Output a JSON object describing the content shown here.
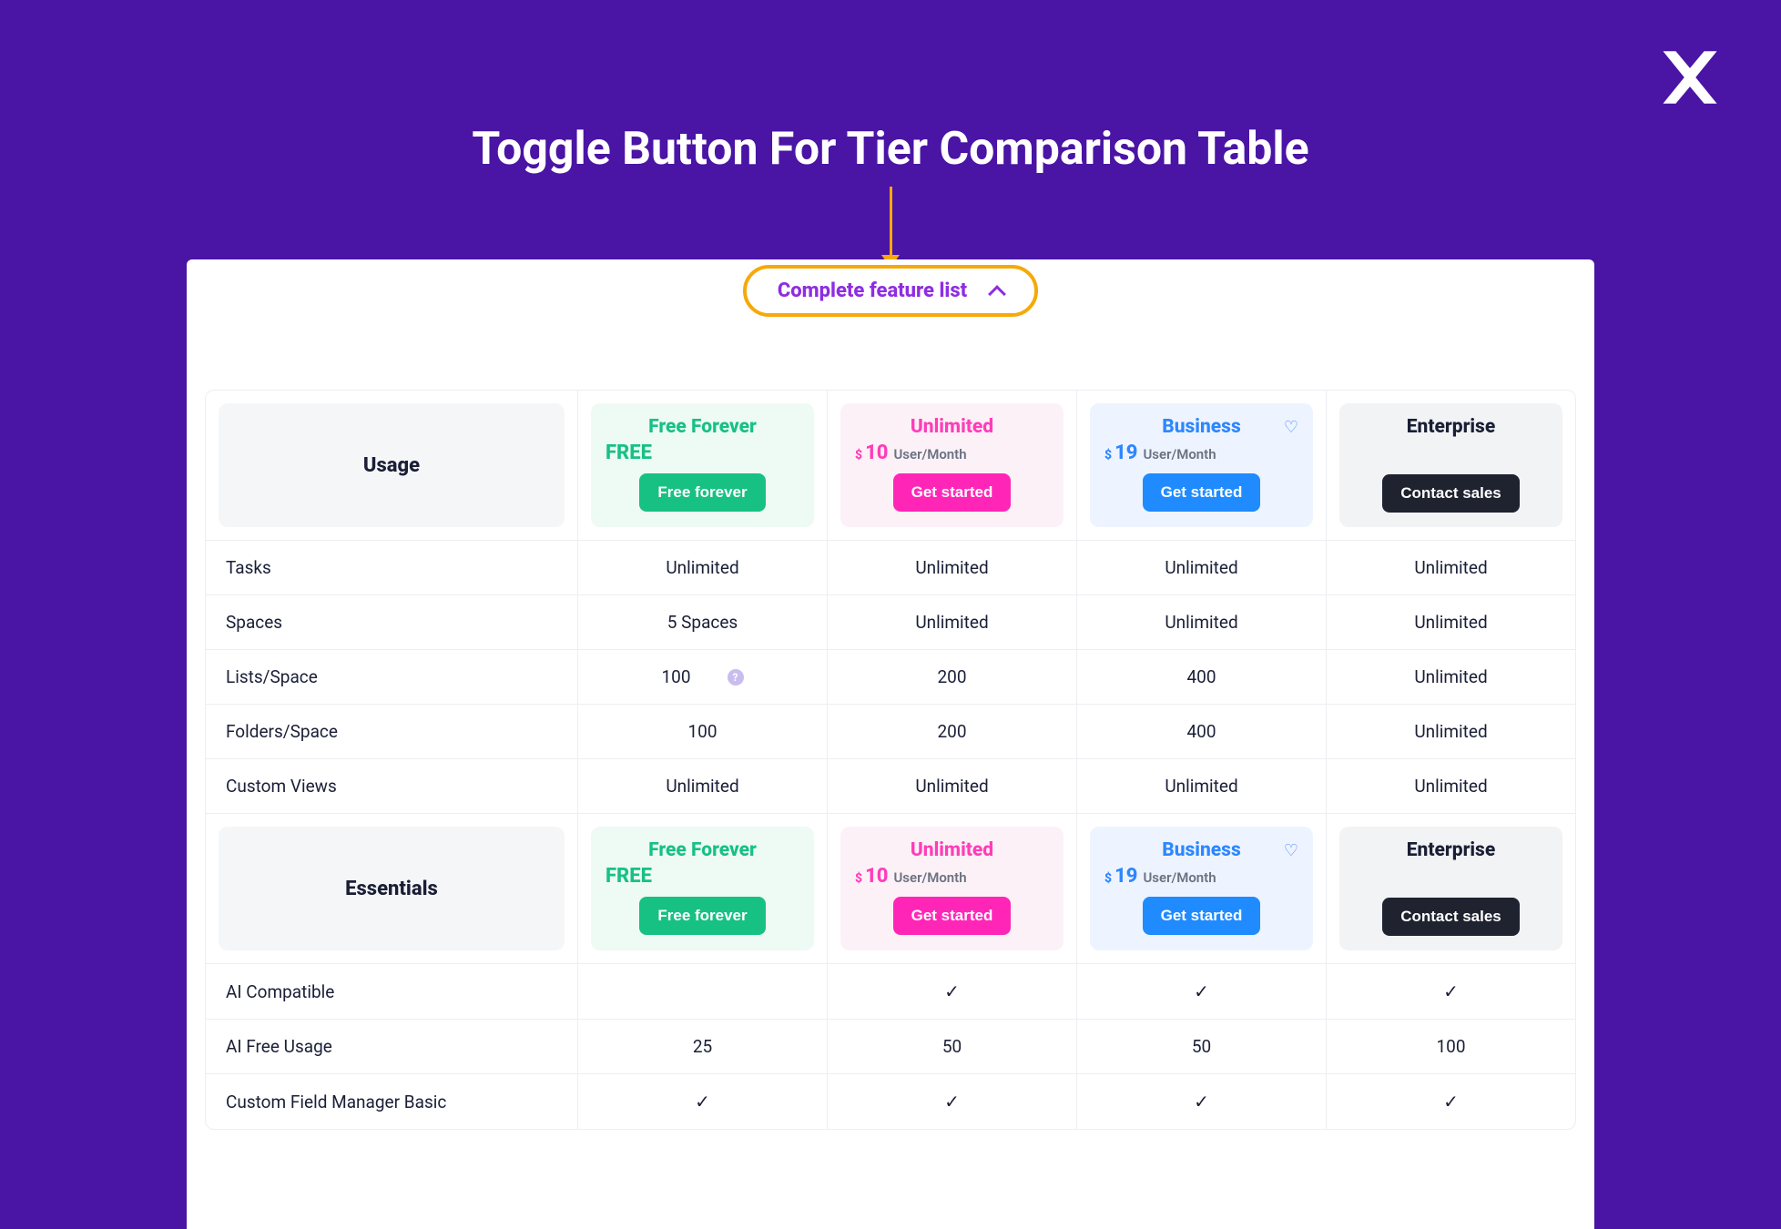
{
  "title": "Toggle Button For Tier Comparison Table",
  "toggle_label": "Complete feature list",
  "plans": {
    "free": {
      "name": "Free Forever",
      "price": "FREE",
      "unit": "",
      "cta": "Free forever",
      "bg": "#eefaf4",
      "name_color": "#17c184",
      "price_color": "#17c184",
      "btn_bg": "#17c184"
    },
    "unlimited": {
      "name": "Unlimited",
      "dollar": "$",
      "price": "10",
      "unit": "User/Month",
      "cta": "Get started",
      "bg": "#fdf1f8",
      "name_color": "#ff3db8",
      "price_color": "#ff3db8",
      "btn_bg": "#ff26b7"
    },
    "business": {
      "name": "Business",
      "dollar": "$",
      "price": "19",
      "unit": "User/Month",
      "cta": "Get started",
      "bg": "#eef4ff",
      "name_color": "#2d87ff",
      "price_color": "#2d87ff",
      "btn_bg": "#1f8bff",
      "heart": "♡"
    },
    "enterprise": {
      "name": "Enterprise",
      "price": "",
      "unit": "",
      "cta": "Contact sales",
      "bg": "#f2f3f5",
      "name_color": "#1a1f36",
      "price_color": "#1a1f36",
      "btn_bg": "#1f2330"
    }
  },
  "sections": [
    {
      "title": "Usage",
      "rows": [
        {
          "label": "Tasks",
          "values": [
            "Unlimited",
            "Unlimited",
            "Unlimited",
            "Unlimited"
          ]
        },
        {
          "label": "Spaces",
          "values": [
            "5 Spaces",
            "Unlimited",
            "Unlimited",
            "Unlimited"
          ]
        },
        {
          "label": "Lists/Space",
          "values": [
            "100",
            "200",
            "400",
            "Unlimited"
          ],
          "help_after_col": 0
        },
        {
          "label": "Folders/Space",
          "values": [
            "100",
            "200",
            "400",
            "Unlimited"
          ]
        },
        {
          "label": "Custom Views",
          "values": [
            "Unlimited",
            "Unlimited",
            "Unlimited",
            "Unlimited"
          ]
        }
      ]
    },
    {
      "title": "Essentials",
      "rows": [
        {
          "label": "AI Compatible",
          "values": [
            "",
            "✓",
            "✓",
            "✓"
          ]
        },
        {
          "label": "AI Free Usage",
          "values": [
            "25",
            "50",
            "50",
            "100"
          ]
        },
        {
          "label": "Custom Field Manager Basic",
          "values": [
            "✓",
            "✓",
            "✓",
            "✓"
          ]
        }
      ]
    }
  ]
}
